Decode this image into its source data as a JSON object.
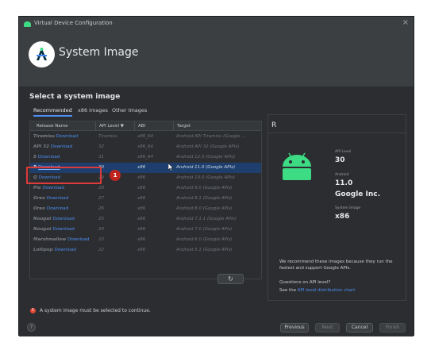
{
  "window": {
    "title": "Virtual Device Configuration",
    "close": "×"
  },
  "header": {
    "title": "System Image"
  },
  "section": {
    "title": "Select a system image"
  },
  "tabs": [
    {
      "label": "Recommended"
    },
    {
      "label": "x86 Images"
    },
    {
      "label": "Other Images"
    }
  ],
  "table": {
    "columns": [
      "Release Name",
      "API Level ▼",
      "ABI",
      "Target"
    ],
    "rows": [
      {
        "name": "Tiramisu",
        "action": "Download",
        "api": "Tiramisu",
        "abi": "x86_64",
        "target": "Android API Tiramisu (Google ..."
      },
      {
        "name": "API 32",
        "action": "Download",
        "api": "32",
        "abi": "x86_64",
        "target": "Android API 32 (Google APIs)"
      },
      {
        "name": "S",
        "action": "Download",
        "api": "31",
        "abi": "x86_64",
        "target": "Android 12.0 (Google APIs)"
      },
      {
        "name": "R",
        "action": "Download",
        "api": "30",
        "abi": "x86",
        "target": "Android 11.0 (Google APIs)"
      },
      {
        "name": "Q",
        "action": "Download",
        "api": "29",
        "abi": "x86",
        "target": "Android 10.0 (Google APIs)"
      },
      {
        "name": "Pie",
        "action": "Download",
        "api": "28",
        "abi": "x86",
        "target": "Android 9.0 (Google APIs)"
      },
      {
        "name": "Oreo",
        "action": "Download",
        "api": "27",
        "abi": "x86",
        "target": "Android 8.1 (Google APIs)"
      },
      {
        "name": "Oreo",
        "action": "Download",
        "api": "26",
        "abi": "x86",
        "target": "Android 8.0 (Google APIs)"
      },
      {
        "name": "Nougat",
        "action": "Download",
        "api": "25",
        "abi": "x86",
        "target": "Android 7.1.1 (Google APIs)"
      },
      {
        "name": "Nougat",
        "action": "Download",
        "api": "24",
        "abi": "x86",
        "target": "Android 7.0 (Google APIs)"
      },
      {
        "name": "Marshmallow",
        "action": "Download",
        "api": "23",
        "abi": "x86",
        "target": "Android 6.0 (Google APIs)"
      },
      {
        "name": "Lollipop",
        "action": "Download",
        "api": "22",
        "abi": "x86",
        "target": "Android 5.1 (Google APIs)"
      }
    ],
    "refresh": "↻"
  },
  "annotation": {
    "badge": "1"
  },
  "details": {
    "title": "R",
    "api_label": "API Level",
    "api_value": "30",
    "android_label": "Android",
    "android_value": "11.0",
    "vendor_value": "Google Inc.",
    "image_label": "System Image",
    "image_value": "x86",
    "recommend": "We recommend these images because they run the fastest and support Google APIs.",
    "questions": "Questions on API level?",
    "see_the": "See the",
    "link": "API level distribution chart"
  },
  "error": {
    "icon": "!",
    "text": "A system image must be selected to continue."
  },
  "footer": {
    "help": "?",
    "previous": "Previous",
    "next": "Next",
    "cancel": "Cancel",
    "finish": "Finish"
  },
  "colors": {
    "accent": "#4d8ff5",
    "android_green": "#3ddc84",
    "error": "#e5493a",
    "annotation": "#e03a3a"
  }
}
